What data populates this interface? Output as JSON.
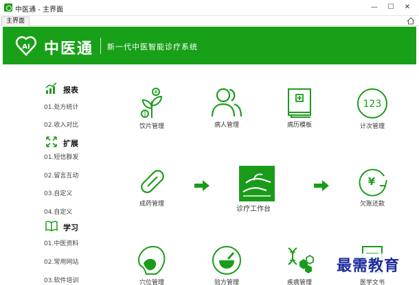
{
  "window": {
    "title": "中医通 - 主界面",
    "min": "—",
    "max": "☐",
    "close": "✕"
  },
  "tabs": [
    {
      "label": "主界面"
    }
  ],
  "header": {
    "logo_text": "中医通",
    "slogan": "新一代中医智能诊疗系统"
  },
  "sidebar": {
    "sections": [
      {
        "label": "报表",
        "icon": "bar-chart-icon",
        "items": [
          "01.处方统计",
          "02.收入对比"
        ]
      },
      {
        "label": "扩展",
        "icon": "expand-icon",
        "items": [
          "01.短信群发",
          "02.留言互动",
          "03.自定义",
          "04.自定义"
        ]
      },
      {
        "label": "学习",
        "icon": "book-icon",
        "items": [
          "01.中医资料",
          "02.常用网站",
          "03.软件培训"
        ]
      }
    ]
  },
  "tiles": {
    "row1": [
      "饮片管理",
      "病人管理",
      "病历模板",
      "计次管理"
    ],
    "row2_left": "成药管理",
    "center": "诊疗工作台",
    "row2_right": "欠账还款",
    "row3": [
      "穴位管理",
      "验方管理",
      "疾病管理",
      "医学文书"
    ]
  },
  "counter_icon_text": "123",
  "yen_symbol": "¥",
  "watermark": "最需教育",
  "colors": {
    "brand_green": "#19a019",
    "icon_green": "#1a9c1a",
    "watermark_blue": "#1f2d9c"
  }
}
